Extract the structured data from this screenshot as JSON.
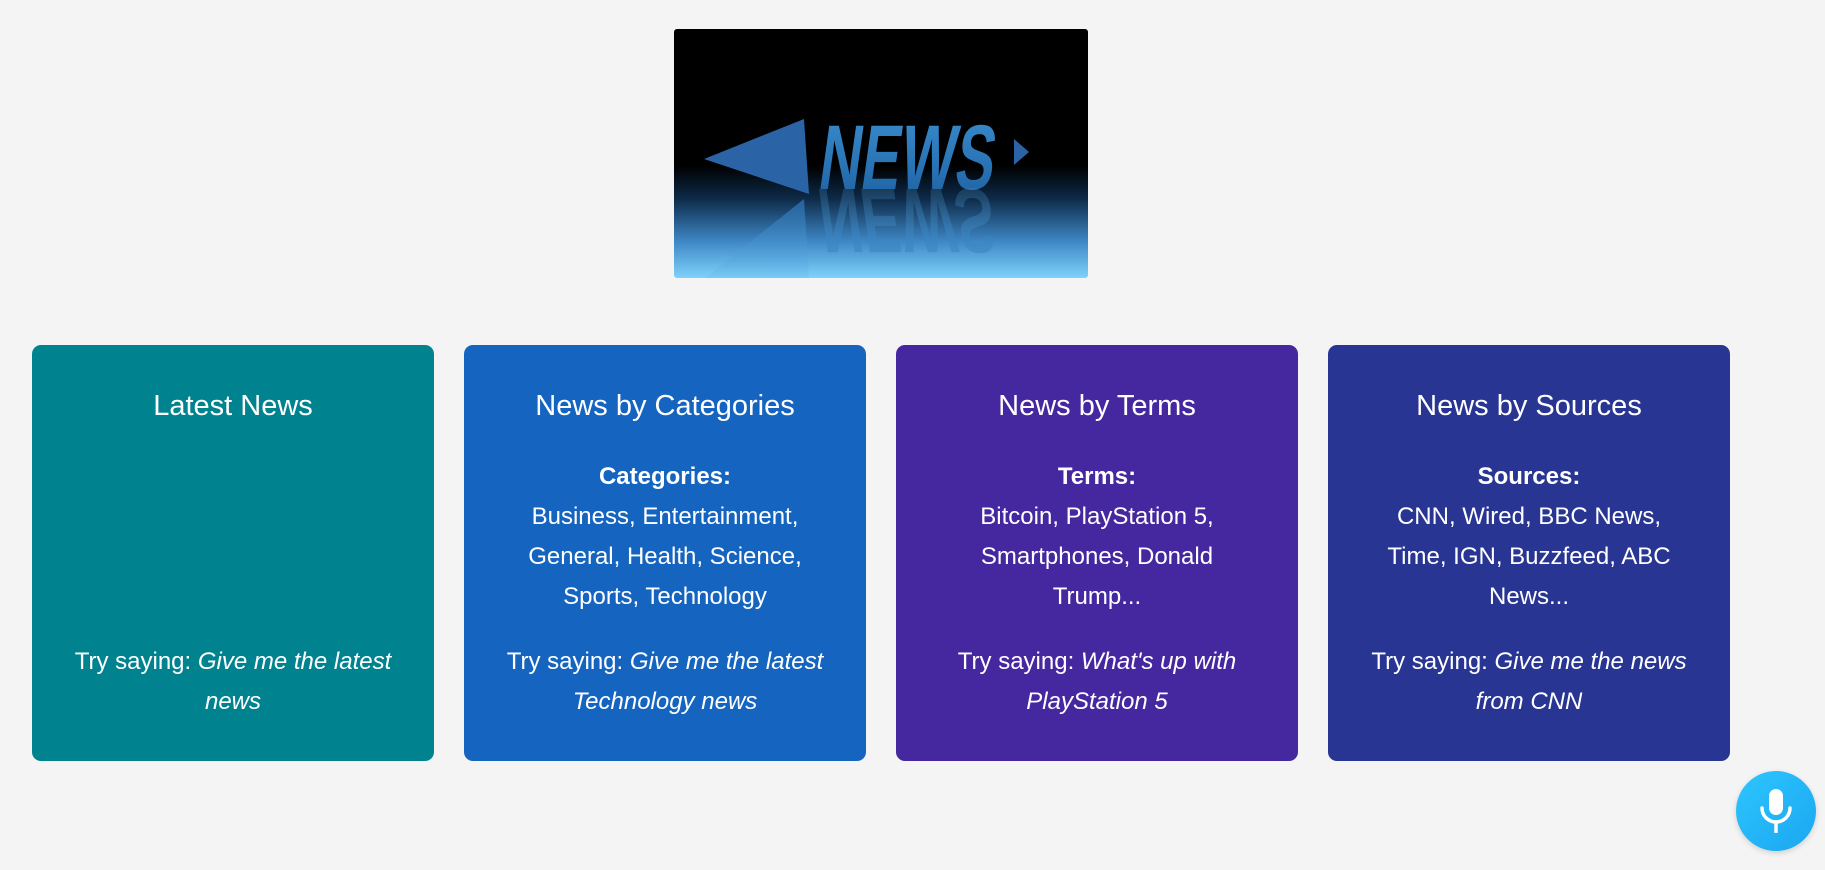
{
  "logo": {
    "word": "NEWS",
    "icon": "news-3d-logo"
  },
  "cards": [
    {
      "title": "Latest News",
      "info_head": "",
      "info_text": "",
      "try_prefix": "Try saying: ",
      "try_example": "Give me the latest news",
      "color": "#00838f"
    },
    {
      "title": "News by Categories",
      "info_head": "Categories:",
      "info_text": "Business, Entertainment, General, Health, Science, Sports, Technology",
      "try_prefix": "Try saying: ",
      "try_example": "Give me the latest Technology news",
      "color": "#1565c0"
    },
    {
      "title": "News by Terms",
      "info_head": "Terms:",
      "info_text": "Bitcoin, PlayStation 5, Smartphones, Donald Trump...",
      "try_prefix": "Try saying: ",
      "try_example": "What's up with PlayStation 5",
      "color": "#4527a0"
    },
    {
      "title": "News by Sources",
      "info_head": "Sources:",
      "info_text": "CNN, Wired, BBC News, Time, IGN, Buzzfeed, ABC News...",
      "try_prefix": "Try saying: ",
      "try_example": "Give me the news from CNN",
      "color": "#283593"
    }
  ],
  "mic": {
    "icon": "microphone-icon",
    "color": "#1aa6f0"
  }
}
